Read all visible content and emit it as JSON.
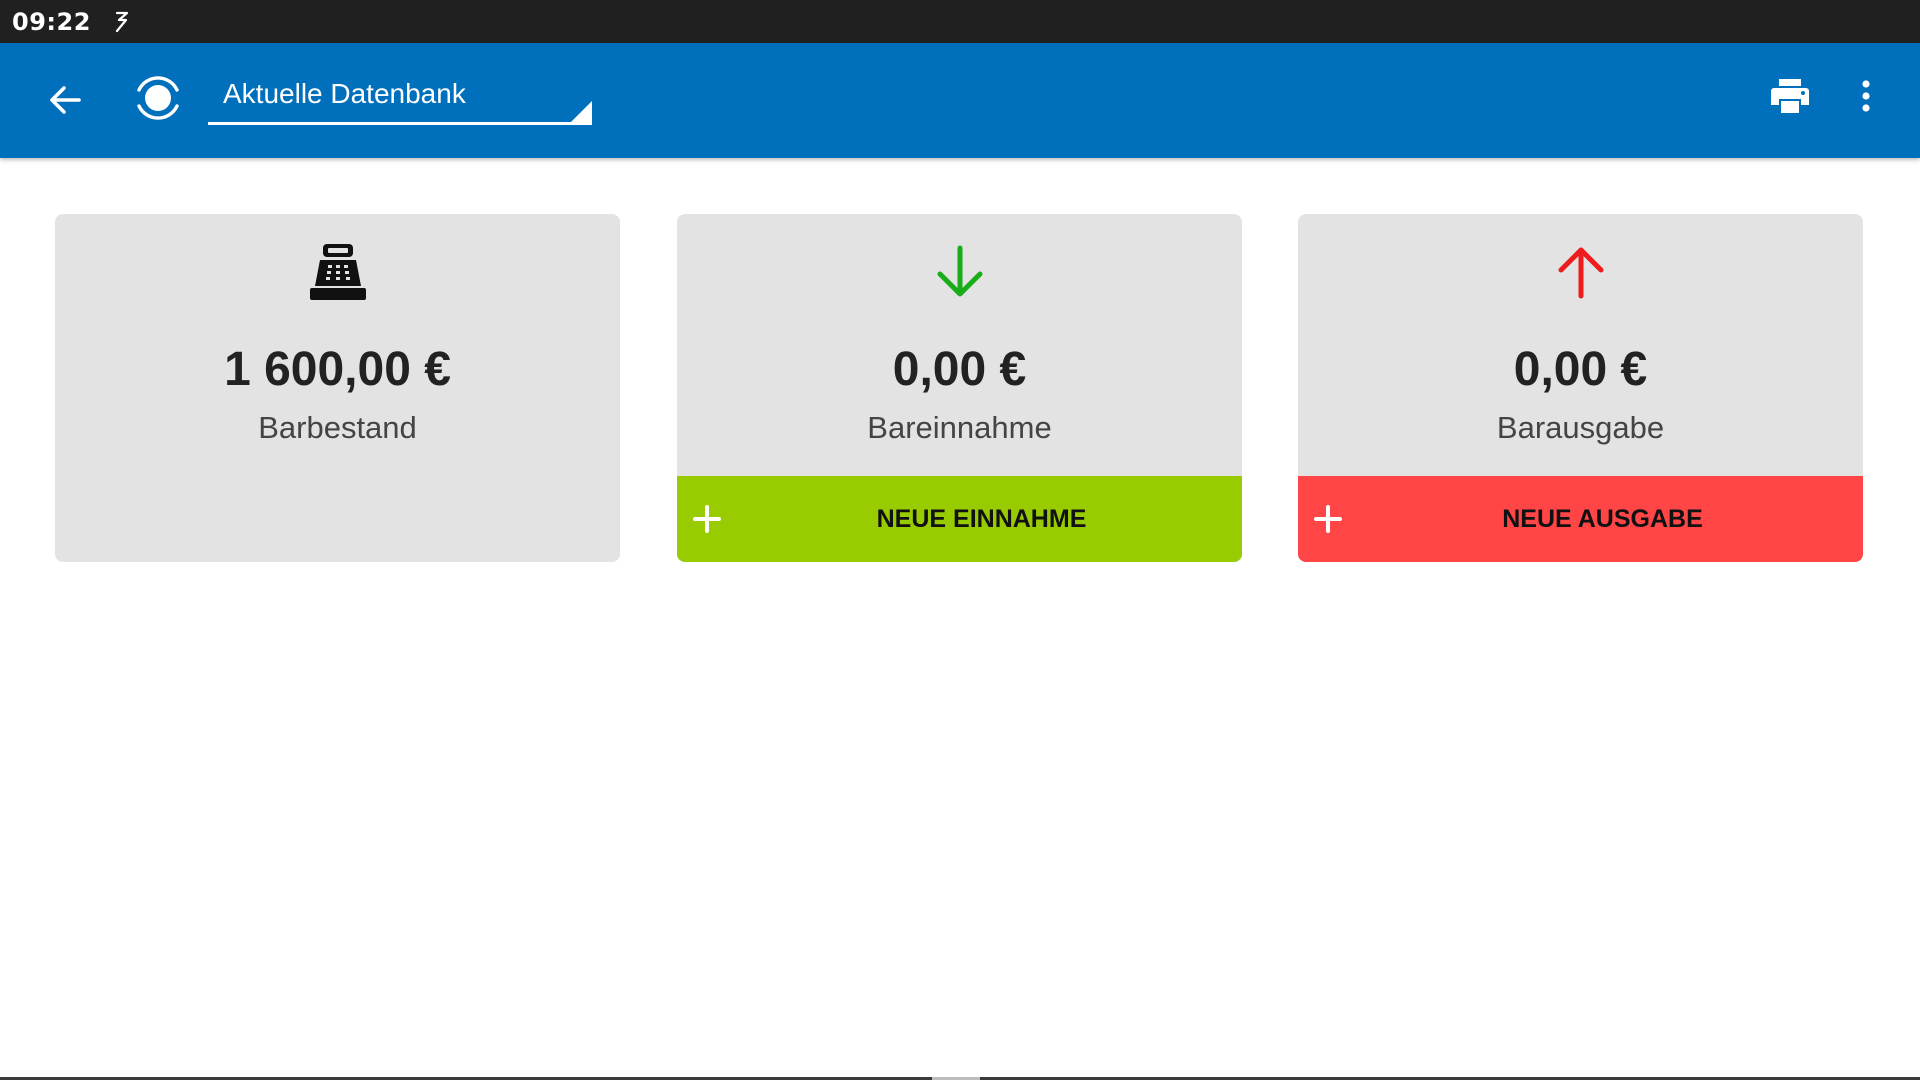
{
  "status_bar": {
    "time": "09:22",
    "notification_icon": "sync-icon"
  },
  "app_bar": {
    "back_icon": "arrow-back-icon",
    "logo_icon": "app-logo-icon",
    "database_select": {
      "value": "Aktuelle Datenbank"
    },
    "print_icon": "printer-icon",
    "more_icon": "more-vert-icon"
  },
  "cards": [
    {
      "icon": "cash-register-icon",
      "value": "1 600,00 €",
      "label": "Barbestand"
    },
    {
      "icon": "arrow-down-icon",
      "icon_color": "#1aad1a",
      "value": "0,00 €",
      "label": "Bareinnahme",
      "action": {
        "label": "NEUE EINNAHME",
        "color": "#99cc00"
      }
    },
    {
      "icon": "arrow-up-icon",
      "icon_color": "#ee1c1c",
      "value": "0,00 €",
      "label": "Barausgabe",
      "action": {
        "label": "NEUE AUSGABE",
        "color": "#ff4545"
      }
    }
  ],
  "colors": {
    "app_bar": "#0070bd",
    "status_bar": "#202020",
    "card_background": "#e3e3e3"
  }
}
